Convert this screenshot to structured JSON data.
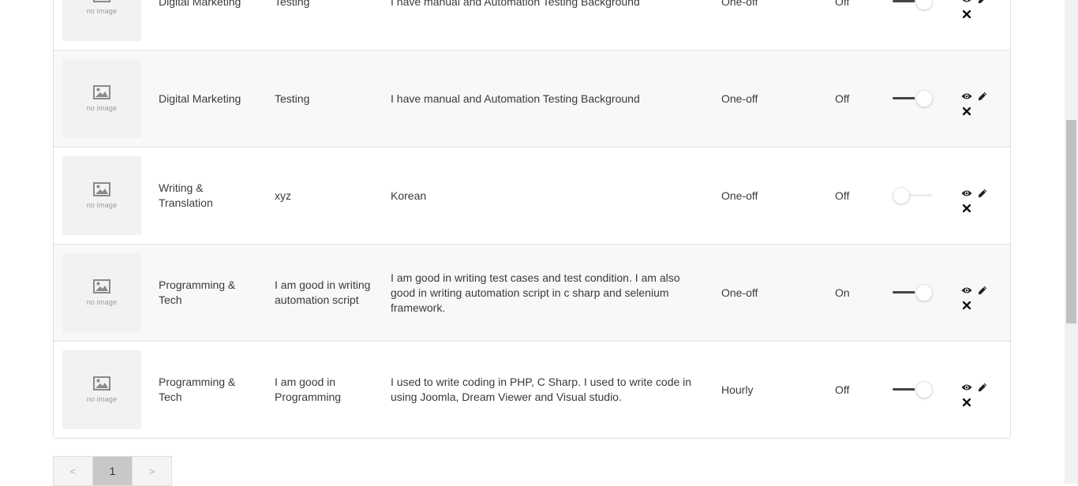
{
  "rows": [
    {
      "category": "Digital Marketing",
      "title": "Testing",
      "description": "I have manual and Automation Testing Background",
      "type": "One-off",
      "status": "Off",
      "toggle": "on",
      "no_image": "no image"
    },
    {
      "category": "Digital Marketing",
      "title": "Testing",
      "description": "I have manual and Automation Testing Background",
      "type": "One-off",
      "status": "Off",
      "toggle": "on",
      "no_image": "no image"
    },
    {
      "category": "Writing & Translation",
      "title": "xyz",
      "description": "Korean",
      "type": "One-off",
      "status": "Off",
      "toggle": "off",
      "no_image": "no image"
    },
    {
      "category": "Programming & Tech",
      "title": "I am good in writing automation script",
      "description": "I am good in writing test cases and test condition. I am also good in writing automation script in c sharp and selenium framework.",
      "type": "One-off",
      "status": "On",
      "toggle": "on",
      "no_image": "no image"
    },
    {
      "category": "Programming & Tech",
      "title": "I am good in Programming",
      "description": "I used to write coding in PHP, C Sharp. I used to write code in using Joomla, Dream Viewer and Visual studio.",
      "type": "Hourly",
      "status": "Off",
      "toggle": "on",
      "no_image": "no image"
    }
  ],
  "pagination": {
    "prev": "<",
    "current": "1",
    "next": ">"
  },
  "icons": {
    "view": "eye-icon",
    "edit": "pencil-icon",
    "delete": "close-icon",
    "placeholder": "image-icon"
  }
}
